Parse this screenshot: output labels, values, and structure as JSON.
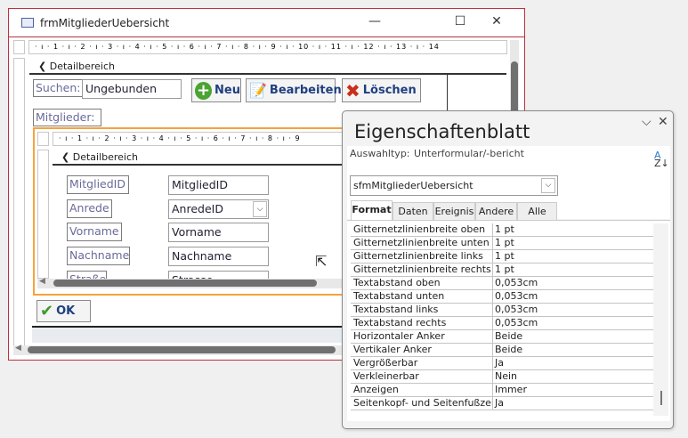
{
  "form": {
    "title": "frmMitgliederUebersicht",
    "minimize": "—",
    "maximize": "☐",
    "close": "✕",
    "ruler_top": "· ı · 1 · ı · 2 · ı · 3 · ı · 4 · ı · 5 · ı · 6 · ı · 7 · ı · 8 · ı · 9 · ı · 10 · ı · 11 · ı · 12 · ı · 13 · ı · 14",
    "section": "Detailbereich",
    "search_label": "Suchen:",
    "search_value": "Ungebunden",
    "buttons": {
      "new": "Neu",
      "edit": "Bearbeiten",
      "delete": "Löschen",
      "ok": "OK"
    },
    "members_label": "Mitglieder:"
  },
  "subform": {
    "ruler_top": "· ı · 1 · ı · 2 · ı · 3 · ı · 4 · ı · 5 · ı · 6 · ı · 7 · ı · 8 · ı · 9",
    "section": "Detailbereich",
    "fields": [
      {
        "label": "MitgliedID",
        "control": "MitgliedID"
      },
      {
        "label": "Anrede",
        "control": "AnredeID",
        "combo": true
      },
      {
        "label": "Vorname",
        "control": "Vorname"
      },
      {
        "label": "Nachname",
        "control": "Nachname"
      },
      {
        "label": "Straße",
        "control": "Strasse"
      }
    ]
  },
  "property_sheet": {
    "title": "Eigenschaftenblatt",
    "selection_type_label": "Auswahltyp:",
    "selection_type": "Unterformular/-bericht",
    "object": "sfmMitgliederUebersicht",
    "tabs": [
      "Format",
      "Daten",
      "Ereignis",
      "Andere",
      "Alle"
    ],
    "active_tab": "Format",
    "rows": [
      [
        "Gitternetzlinienbreite oben",
        "1 pt"
      ],
      [
        "Gitternetzlinienbreite unten",
        "1 pt"
      ],
      [
        "Gitternetzlinienbreite links",
        "1 pt"
      ],
      [
        "Gitternetzlinienbreite rechts",
        "1 pt"
      ],
      [
        "Textabstand oben",
        "0,053cm"
      ],
      [
        "Textabstand unten",
        "0,053cm"
      ],
      [
        "Textabstand links",
        "0,053cm"
      ],
      [
        "Textabstand rechts",
        "0,053cm"
      ],
      [
        "Horizontaler Anker",
        "Beide"
      ],
      [
        "Vertikaler Anker",
        "Beide"
      ],
      [
        "Vergrößerbar",
        "Ja"
      ],
      [
        "Verkleinerbar",
        "Nein"
      ],
      [
        "Anzeigen",
        "Immer"
      ],
      [
        "Seitenkopf- und Seitenfußzeile",
        "Ja"
      ]
    ]
  },
  "colors": {
    "accent_orange": "#f7a239",
    "window_border": "#b8323f",
    "button_text": "#1f3f7f"
  }
}
